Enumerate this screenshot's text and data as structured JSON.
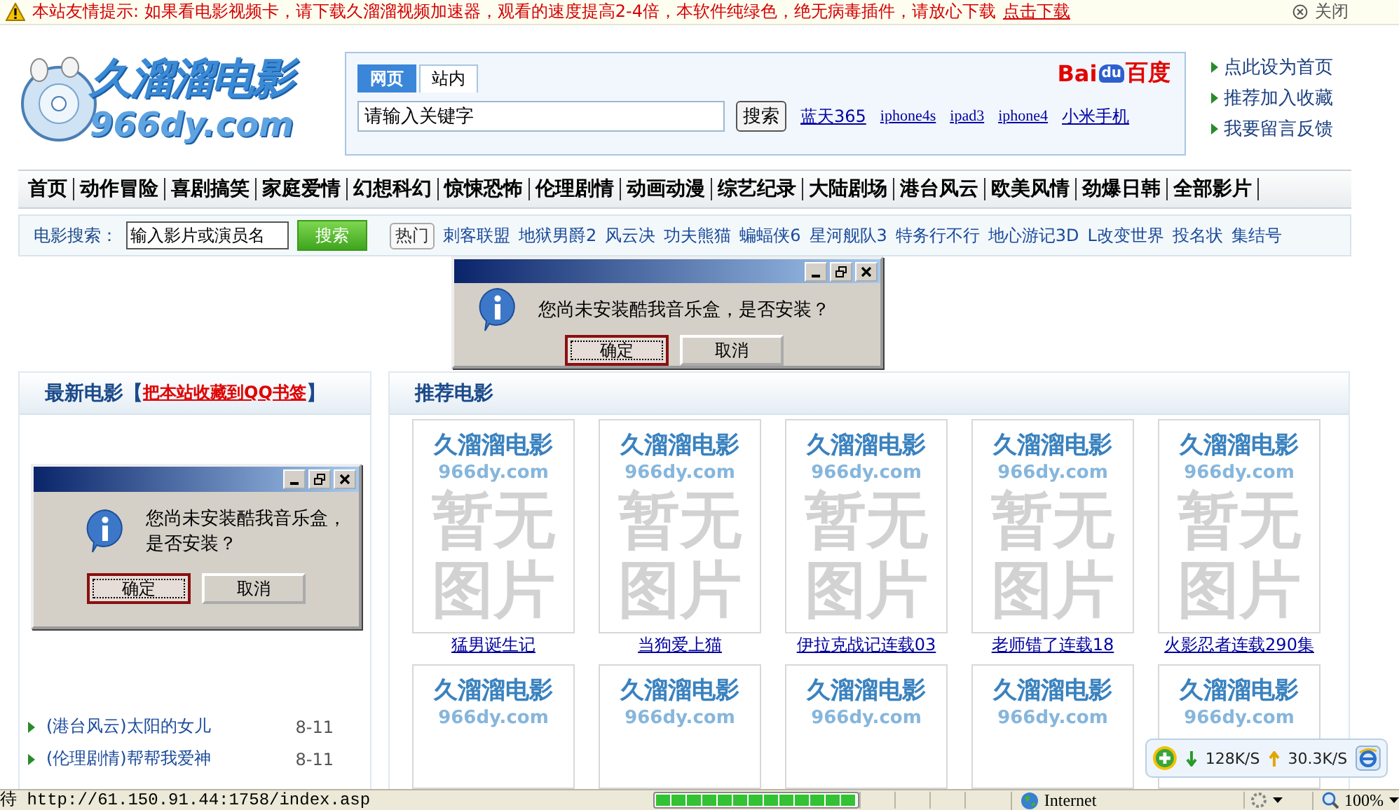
{
  "notice_bar": {
    "message": "本站友情提示: 如果看电影视频卡，请下载久溜溜视频加速器，观看的速度提高2-4倍，本软件纯绿色，绝无病毒插件，请放心下载",
    "link": "点击下载",
    "close": "关闭"
  },
  "header": {
    "logo": {
      "name": "久溜溜电影",
      "domain": "966dy.com"
    },
    "search_tabs": [
      {
        "label": "网页",
        "selected": true
      },
      {
        "label": "站内",
        "selected": false
      }
    ],
    "baidu": {
      "left": "Bai",
      "middle": "du",
      "right": "百度"
    },
    "search": {
      "placeholder": "请输入关键字",
      "button": "搜索"
    },
    "quick_links": [
      "蓝天365",
      "iphone4s",
      "ipad3",
      "iphone4",
      "小米手机"
    ],
    "side_links": [
      "点此设为首页",
      "推荐加入收藏",
      "我要留言反馈"
    ]
  },
  "nav": [
    "首页",
    "动作冒险",
    "喜剧搞笑",
    "家庭爱情",
    "幻想科幻",
    "惊悚恐怖",
    "伦理剧情",
    "动画动漫",
    "综艺纪录",
    "大陆剧场",
    "港台风云",
    "欧美风情",
    "劲爆日韩",
    "全部影片"
  ],
  "movie_search": {
    "label": "电影搜索：",
    "value": "输入影片或演员名",
    "button": "搜索",
    "hot_label": "热门",
    "hot_links": [
      "刺客联盟",
      "地狱男爵2",
      "风云决",
      "功夫熊猫",
      "蝙蝠侠6",
      "星河舰队3",
      "特务行不行",
      "地心游记3D",
      "L改变世界",
      "投名状",
      "集结号"
    ]
  },
  "dialogs": [
    {
      "message": "您尚未安装酷我音乐盒，是否安装？",
      "buttons": [
        {
          "label": "确定",
          "default": true
        },
        {
          "label": "取消",
          "default": false
        }
      ]
    },
    {
      "message": "您尚未安装酷我音乐盒，是否安装？",
      "buttons": [
        {
          "label": "确定",
          "default": true
        },
        {
          "label": "取消",
          "default": false
        }
      ]
    }
  ],
  "latest": {
    "title": "最新电影",
    "bracket_open": "【",
    "bookmark_link": "把本站收藏到QQ书签",
    "bracket_close": "】",
    "items": [
      {
        "title": "(港台风云)太阳的女儿",
        "date": "8-11"
      },
      {
        "title": "(伦理剧情)帮帮我爱神",
        "date": "8-11"
      }
    ]
  },
  "recommended": {
    "title": "推荐电影",
    "movies": [
      {
        "brand": "久溜溜电影",
        "domain": "966dy.com",
        "notice": "暂无图片",
        "caption": "猛男诞生记"
      },
      {
        "brand": "久溜溜电影",
        "domain": "966dy.com",
        "notice": "暂无图片",
        "caption": "当狗爱上猫"
      },
      {
        "brand": "久溜溜电影",
        "domain": "966dy.com",
        "notice": "暂无图片",
        "caption": "伊拉克战记连载03"
      },
      {
        "brand": "久溜溜电影",
        "domain": "966dy.com",
        "notice": "暂无图片",
        "caption": "老师错了连载18"
      },
      {
        "brand": "久溜溜电影",
        "domain": "966dy.com",
        "notice": "暂无图片",
        "caption": "火影忍者连载290集"
      },
      {
        "brand": "久溜溜电影",
        "domain": "966dy.com"
      },
      {
        "brand": "久溜溜电影",
        "domain": "966dy.com"
      },
      {
        "brand": "久溜溜电影",
        "domain": "966dy.com"
      },
      {
        "brand": "久溜溜电影",
        "domain": "966dy.com"
      },
      {
        "brand": "久溜溜电影",
        "domain": "966dy.com"
      }
    ]
  },
  "speed_widget": {
    "download": "128K/S",
    "upload": "30.3K/S"
  },
  "status_bar": {
    "text": "待 http://61.150.91.44:1758/index.asp",
    "progress": {
      "level": 1
    },
    "zone": "Internet",
    "zoom": "100%"
  }
}
